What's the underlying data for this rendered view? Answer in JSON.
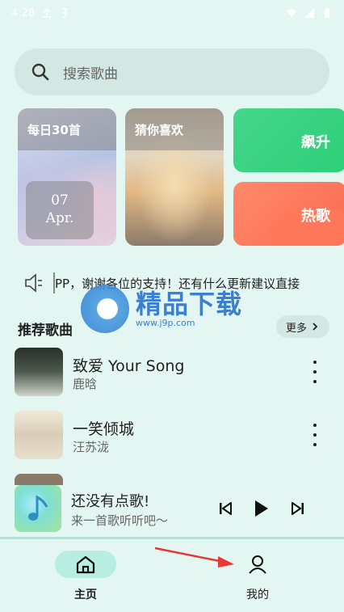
{
  "status": {
    "time": "4:28"
  },
  "search": {
    "placeholder": "搜索歌曲"
  },
  "cards": {
    "daily": {
      "label": "每日30首",
      "day": "07",
      "month": "Apr."
    },
    "guess": {
      "label": "猜你喜欢"
    },
    "soar": {
      "label": "飙升"
    },
    "hot": {
      "label": "热歌"
    }
  },
  "notice": {
    "text": "PP，谢谢各位的支持！还有什么更新建议直接"
  },
  "watermark": {
    "name": "精品下载",
    "url": "www.j9p.com"
  },
  "recommend": {
    "title": "推荐歌曲",
    "more_label": "更多",
    "songs": [
      {
        "title": "致爱 Your Song",
        "artist": "鹿晗"
      },
      {
        "title": "一笑倾城",
        "artist": "汪苏泷"
      }
    ]
  },
  "player": {
    "title": "还没有点歌!",
    "subtitle": "来一首歌听听吧～"
  },
  "tabs": [
    {
      "label": "主页",
      "active": true
    },
    {
      "label": "我的",
      "active": false
    }
  ],
  "colors": {
    "accent": "#b8ede2",
    "background": "#e4f6f2",
    "annotation_arrow": "#e53935"
  }
}
